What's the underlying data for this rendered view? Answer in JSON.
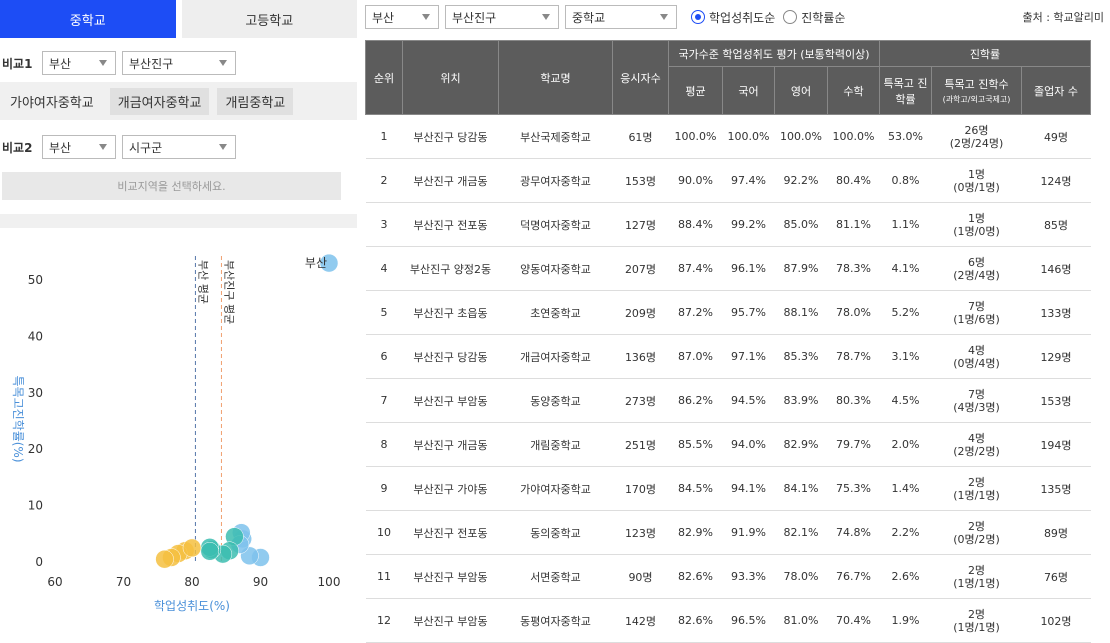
{
  "tabs": {
    "middle": "중학교",
    "high": "고등학교"
  },
  "compare1": {
    "label": "비교1",
    "region": "부산",
    "district": "부산진구"
  },
  "schools": [
    "가야여자중학교",
    "개금여자중학교",
    "개림중학교"
  ],
  "compare2": {
    "label": "비교2",
    "region": "부산",
    "district": "시구군"
  },
  "hint": "비교지역을 선택하세요.",
  "filter": {
    "region": "부산",
    "district": "부산진구",
    "level": "중학교",
    "sort_achievement": "학업성취도순",
    "sort_advance": "진학률순",
    "source": "출처 : 학교알리미"
  },
  "table": {
    "headers": {
      "rank": "순위",
      "location": "위치",
      "school": "학교명",
      "examinees": "응시자수",
      "national": "국가수준 학업성취도 평가 (보통학력이상)",
      "avg": "평균",
      "korean": "국어",
      "english": "영어",
      "math": "수학",
      "advance": "진학률",
      "special_rate": "특목고 진학률",
      "special_count": "특목고 진학수",
      "special_count_sub": "(과학고/외고국제고)",
      "graduates": "졸업자 수"
    },
    "rows": [
      {
        "rank": "1",
        "loc": "부산진구 당감동",
        "name": "부산국제중학교",
        "n": "61명",
        "avg": "100.0%",
        "kor": "100.0%",
        "eng": "100.0%",
        "math": "100.0%",
        "rate": "53.0%",
        "cnt": "26명",
        "cnt_sub": "(2명/24명)",
        "grad": "49명"
      },
      {
        "rank": "2",
        "loc": "부산진구 개금동",
        "name": "광무여자중학교",
        "n": "153명",
        "avg": "90.0%",
        "kor": "97.4%",
        "eng": "92.2%",
        "math": "80.4%",
        "rate": "0.8%",
        "cnt": "1명",
        "cnt_sub": "(0명/1명)",
        "grad": "124명"
      },
      {
        "rank": "3",
        "loc": "부산진구 전포동",
        "name": "덕명여자중학교",
        "n": "127명",
        "avg": "88.4%",
        "kor": "99.2%",
        "eng": "85.0%",
        "math": "81.1%",
        "rate": "1.1%",
        "cnt": "1명",
        "cnt_sub": "(1명/0명)",
        "grad": "85명"
      },
      {
        "rank": "4",
        "loc": "부산진구 양정2동",
        "name": "양동여자중학교",
        "n": "207명",
        "avg": "87.4%",
        "kor": "96.1%",
        "eng": "87.9%",
        "math": "78.3%",
        "rate": "4.1%",
        "cnt": "6명",
        "cnt_sub": "(2명/4명)",
        "grad": "146명"
      },
      {
        "rank": "5",
        "loc": "부산진구 초읍동",
        "name": "초연중학교",
        "n": "209명",
        "avg": "87.2%",
        "kor": "95.7%",
        "eng": "88.1%",
        "math": "78.0%",
        "rate": "5.2%",
        "cnt": "7명",
        "cnt_sub": "(1명/6명)",
        "grad": "133명"
      },
      {
        "rank": "6",
        "loc": "부산진구 당감동",
        "name": "개금여자중학교",
        "n": "136명",
        "avg": "87.0%",
        "kor": "97.1%",
        "eng": "85.3%",
        "math": "78.7%",
        "rate": "3.1%",
        "cnt": "4명",
        "cnt_sub": "(0명/4명)",
        "grad": "129명"
      },
      {
        "rank": "7",
        "loc": "부산진구 부암동",
        "name": "동양중학교",
        "n": "273명",
        "avg": "86.2%",
        "kor": "94.5%",
        "eng": "83.9%",
        "math": "80.3%",
        "rate": "4.5%",
        "cnt": "7명",
        "cnt_sub": "(4명/3명)",
        "grad": "153명"
      },
      {
        "rank": "8",
        "loc": "부산진구 개금동",
        "name": "개림중학교",
        "n": "251명",
        "avg": "85.5%",
        "kor": "94.0%",
        "eng": "82.9%",
        "math": "79.7%",
        "rate": "2.0%",
        "cnt": "4명",
        "cnt_sub": "(2명/2명)",
        "grad": "194명"
      },
      {
        "rank": "9",
        "loc": "부산진구 가야동",
        "name": "가야여자중학교",
        "n": "170명",
        "avg": "84.5%",
        "kor": "94.1%",
        "eng": "84.1%",
        "math": "75.3%",
        "rate": "1.4%",
        "cnt": "2명",
        "cnt_sub": "(1명/1명)",
        "grad": "135명"
      },
      {
        "rank": "10",
        "loc": "부산진구 전포동",
        "name": "동의중학교",
        "n": "123명",
        "avg": "82.9%",
        "kor": "91.9%",
        "eng": "82.1%",
        "math": "74.8%",
        "rate": "2.2%",
        "cnt": "2명",
        "cnt_sub": "(0명/2명)",
        "grad": "89명"
      },
      {
        "rank": "11",
        "loc": "부산진구 부암동",
        "name": "서면중학교",
        "n": "90명",
        "avg": "82.6%",
        "kor": "93.3%",
        "eng": "78.0%",
        "math": "76.7%",
        "rate": "2.6%",
        "cnt": "2명",
        "cnt_sub": "(1명/1명)",
        "grad": "76명"
      },
      {
        "rank": "12",
        "loc": "부산진구 부암동",
        "name": "동평여자중학교",
        "n": "142명",
        "avg": "82.6%",
        "kor": "96.5%",
        "eng": "81.0%",
        "math": "70.4%",
        "rate": "1.9%",
        "cnt": "2명",
        "cnt_sub": "(1명/1명)",
        "grad": "102명"
      }
    ]
  },
  "chart_data": {
    "type": "scatter",
    "xlabel": "학업성취도(%)",
    "ylabel": "특목고진학률(%)",
    "xlim": [
      60,
      100
    ],
    "ylim": [
      0,
      50
    ],
    "xticks": [
      "60",
      "70",
      "80",
      "90",
      "100"
    ],
    "yticks": [
      "0",
      "10",
      "20",
      "30",
      "40",
      "50"
    ],
    "reference_lines": [
      {
        "label": "부산 평균",
        "x": 80.5,
        "color": "#5577aa"
      },
      {
        "label": "부산진구 평균",
        "x": 84.3,
        "color": "#f0a070"
      }
    ],
    "points": [
      {
        "label": "부산",
        "x": 100.0,
        "y": 53.0,
        "color": "#7ec2ec"
      },
      {
        "label": "",
        "x": 90.0,
        "y": 0.8,
        "color": "#7ec2ec"
      },
      {
        "label": "",
        "x": 88.4,
        "y": 1.1,
        "color": "#7ec2ec"
      },
      {
        "label": "",
        "x": 87.4,
        "y": 4.1,
        "color": "#7ec2ec"
      },
      {
        "label": "",
        "x": 87.2,
        "y": 5.2,
        "color": "#7ec2ec"
      },
      {
        "label": "",
        "x": 87.0,
        "y": 3.1,
        "color": "#7ec2ec"
      },
      {
        "label": "",
        "x": 86.2,
        "y": 4.5,
        "color": "#3cbdb0"
      },
      {
        "label": "",
        "x": 85.5,
        "y": 2.0,
        "color": "#3cbdb0"
      },
      {
        "label": "",
        "x": 84.5,
        "y": 1.4,
        "color": "#3cbdb0"
      },
      {
        "label": "",
        "x": 82.9,
        "y": 2.2,
        "color": "#3cbdb0"
      },
      {
        "label": "",
        "x": 82.6,
        "y": 2.6,
        "color": "#3cbdb0"
      },
      {
        "label": "",
        "x": 82.6,
        "y": 1.9,
        "color": "#3cbdb0"
      },
      {
        "label": "",
        "x": 79.0,
        "y": 2.0,
        "color": "#f5c040"
      },
      {
        "label": "",
        "x": 78.0,
        "y": 1.5,
        "color": "#f5c040"
      },
      {
        "label": "",
        "x": 77.0,
        "y": 0.8,
        "color": "#f5c040"
      },
      {
        "label": "",
        "x": 76.0,
        "y": 0.5,
        "color": "#f5c040"
      },
      {
        "label": "",
        "x": 80.0,
        "y": 2.5,
        "color": "#f5c040"
      }
    ]
  }
}
